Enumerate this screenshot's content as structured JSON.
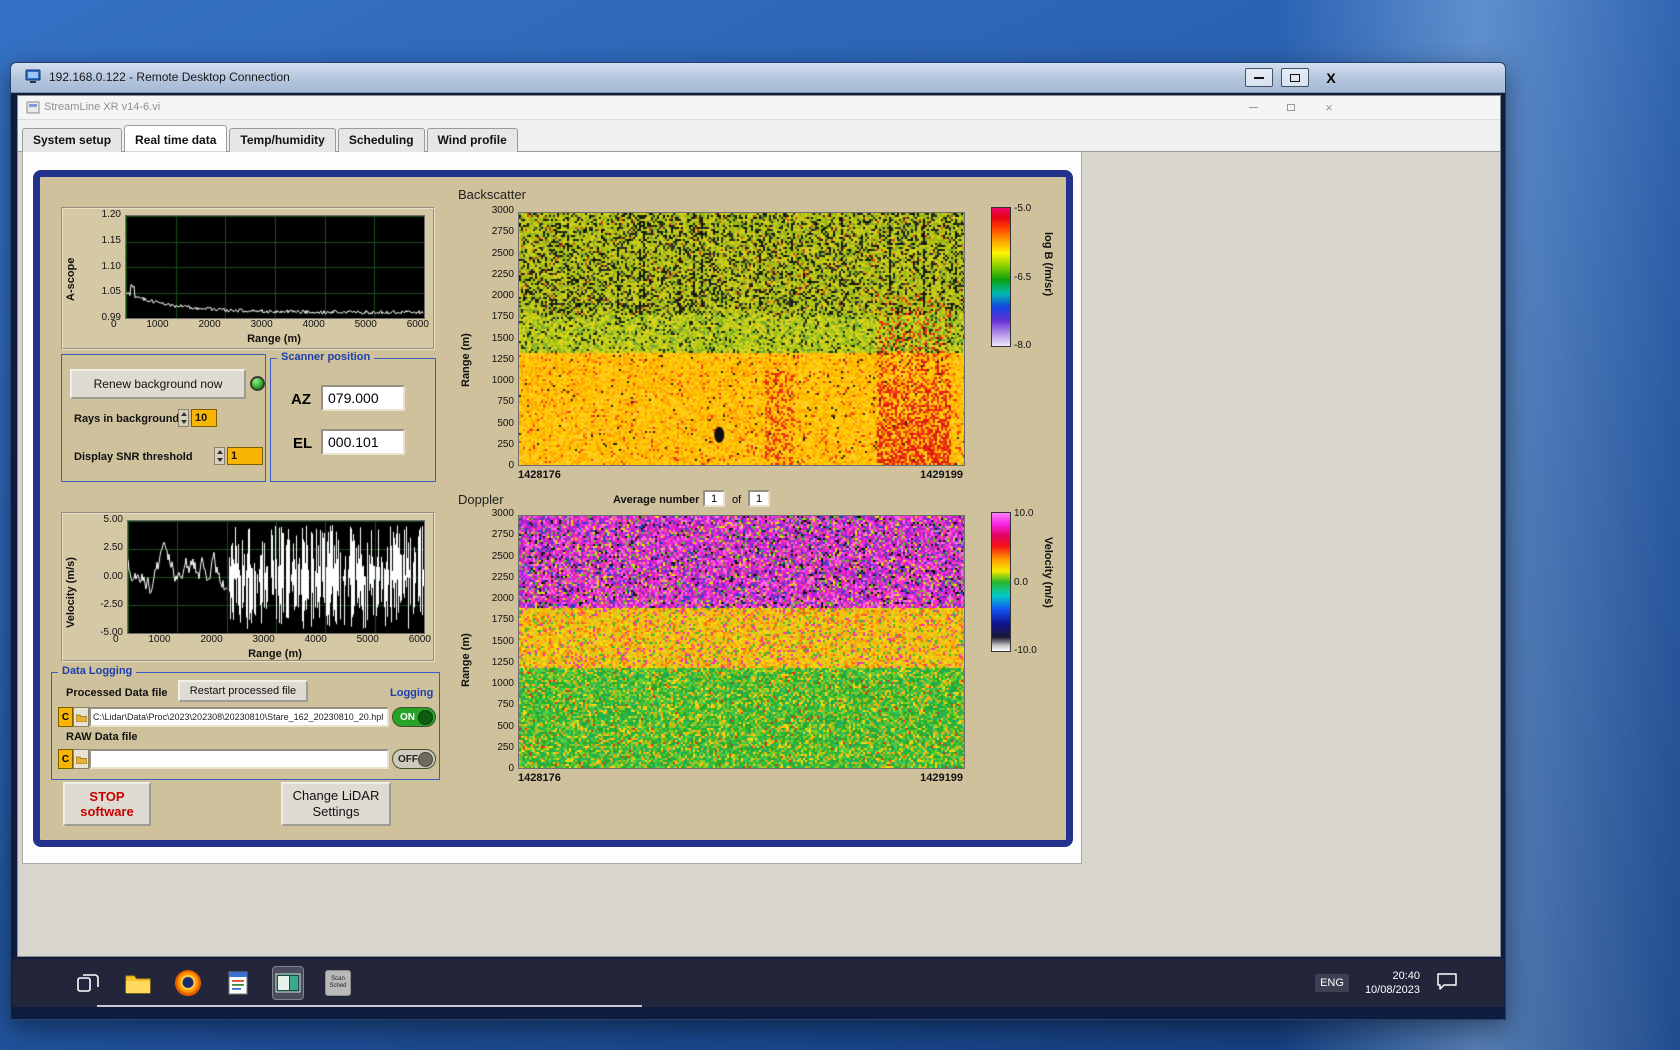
{
  "rdp_window": {
    "title": "192.168.0.122 - Remote Desktop Connection",
    "close_glyph": "X"
  },
  "app_window": {
    "title": "StreamLine XR v14-6.vi",
    "close_glyph": "×"
  },
  "tabs": {
    "items": [
      {
        "label": "System setup"
      },
      {
        "label": "Real time data"
      },
      {
        "label": "Temp/humidity"
      },
      {
        "label": "Scheduling"
      },
      {
        "label": "Wind profile"
      }
    ],
    "active": "Real time data"
  },
  "ascope": {
    "ylabel": "A-scope",
    "yticks": [
      "1.20",
      "1.15",
      "1.10",
      "1.05",
      "0.99"
    ],
    "xticks": [
      "0",
      "1000",
      "2000",
      "3000",
      "4000",
      "5000",
      "6000"
    ],
    "xlabel": "Range (m)"
  },
  "background_controls": {
    "renew_button": "Renew background now",
    "rays_label": "Rays in background",
    "rays_value": "10",
    "snr_label": "Display SNR threshold",
    "snr_value": "1"
  },
  "scanner_position": {
    "title": "Scanner position",
    "az_label": "AZ",
    "az_value": "079.000",
    "el_label": "EL",
    "el_value": "000.101"
  },
  "backscatter": {
    "title": "Backscatter",
    "ylabel": "Range (m)",
    "yticks": [
      "3000",
      "2750",
      "2500",
      "2250",
      "2000",
      "1750",
      "1500",
      "1250",
      "1000",
      "750",
      "500",
      "250",
      "0"
    ],
    "x_start": "1428176",
    "x_end": "1429199",
    "colorbar_label": "log B (/m/sr)",
    "colorbar_ticks": [
      "-5.0",
      "-6.5",
      "-8.0"
    ]
  },
  "doppler": {
    "title": "Doppler",
    "average_label": "Average number",
    "average_value": "1",
    "of_label": "of",
    "average_total": "1",
    "ylabel": "Range (m)",
    "yticks": [
      "3000",
      "2750",
      "2500",
      "2250",
      "2000",
      "1750",
      "1500",
      "1250",
      "1000",
      "750",
      "500",
      "250",
      "0"
    ],
    "x_start": "1428176",
    "x_end": "1429199",
    "colorbar_label": "Velocity (m/s)",
    "colorbar_ticks": [
      "10.0",
      "0.0",
      "-10.0"
    ]
  },
  "velocity_plot": {
    "ylabel": "Velocity (m/s)",
    "yticks": [
      "5.00",
      "2.50",
      "0.00",
      "-2.50",
      "-5.00"
    ],
    "xticks": [
      "0",
      "1000",
      "2000",
      "3000",
      "4000",
      "5000",
      "6000"
    ],
    "xlabel": "Range (m)"
  },
  "data_logging": {
    "title": "Data Logging",
    "processed_label": "Processed Data file",
    "restart_button": "Restart processed file",
    "logging_label": "Logging",
    "drive_letter": "C",
    "processed_path": "C:\\Lidar\\Data\\Proc\\2023\\202308\\20230810\\Stare_162_20230810_20.hpl",
    "processed_toggle": "ON",
    "raw_label": "RAW Data file",
    "raw_path": "",
    "raw_toggle": "OFF"
  },
  "actions": {
    "stop_line1": "STOP",
    "stop_line2": "software",
    "settings_line1": "Change LiDAR",
    "settings_line2": "Settings"
  },
  "taskbar": {
    "language": "ENG",
    "time": "20:40",
    "date": "10/08/2023",
    "scan_tile_line1": "Scan",
    "scan_tile_line2": "Sched"
  }
}
